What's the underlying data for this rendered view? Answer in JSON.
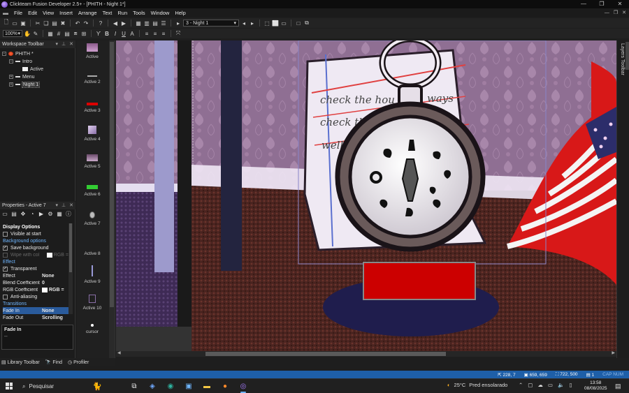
{
  "window": {
    "title": "Clickteam Fusion Developer 2.5+ - [PHITH - Night 1*]",
    "controls": [
      "—",
      "❐",
      "✕"
    ],
    "mdi_controls": [
      "—",
      "❐",
      "✕"
    ]
  },
  "menu": [
    "File",
    "Edit",
    "View",
    "Insert",
    "Arrange",
    "Text",
    "Run",
    "Tools",
    "Window",
    "Help"
  ],
  "toolbar": {
    "zoom": "100%",
    "frame_selector": "3 - Night 1"
  },
  "workspace": {
    "title": "Workspace Toolbar",
    "tree": [
      {
        "label": "PHITH *",
        "level": 0,
        "icon": "app"
      },
      {
        "label": "Intro",
        "level": 1,
        "icon": "frame"
      },
      {
        "label": "Active",
        "level": 2,
        "icon": "object"
      },
      {
        "label": "Menu",
        "level": 1,
        "icon": "frame"
      },
      {
        "label": "Night 1",
        "level": 1,
        "icon": "frame",
        "selected": true
      }
    ]
  },
  "properties": {
    "title": "Properties - Active 7",
    "rows": [
      {
        "type": "section",
        "name": "Display Options"
      },
      {
        "type": "check",
        "name": "Visible at start",
        "checked": false
      },
      {
        "type": "cat",
        "name": "Background options"
      },
      {
        "type": "check",
        "name": "Save background",
        "checked": true
      },
      {
        "type": "check-disabled",
        "name": "Wipe with col",
        "value": "RGB =",
        "checked": false
      },
      {
        "type": "cat",
        "name": "Effect"
      },
      {
        "type": "check",
        "name": "Transparent",
        "checked": true
      },
      {
        "type": "value",
        "name": "Effect",
        "value": "None"
      },
      {
        "type": "value",
        "name": "Blend Coefficient",
        "value": "0"
      },
      {
        "type": "color",
        "name": "RGB Coefficient",
        "value": "RGB ="
      },
      {
        "type": "check",
        "name": "Anti-aliasing",
        "checked": false
      },
      {
        "type": "cat",
        "name": "Transitions"
      },
      {
        "type": "value",
        "name": "Fade In",
        "value": "None",
        "highlight": true
      },
      {
        "type": "value",
        "name": "Fade Out",
        "value": "Scrolling"
      }
    ],
    "description_title": "Fade In",
    "description_text": "--"
  },
  "bottom_tabs": [
    "Library Toolbar",
    "Find",
    "Profiler"
  ],
  "shelf": {
    "items": [
      "Active",
      "Active 2",
      "Active 3",
      "Active 4",
      "Active 5",
      "Active 6",
      "Active 7",
      "Active 8",
      "Active 9",
      "Active 10",
      "cursor"
    ]
  },
  "scene": {
    "note_text": [
      "check the hou",
      "ways",
      "check the",
      "oo",
      "well i"
    ]
  },
  "layers": {
    "title": "Layers Toolbar"
  },
  "status": {
    "mouse": "228, 7",
    "object": "659, 659",
    "frame": "722, 500",
    "layer": "1",
    "tail": "CAP NUM"
  },
  "taskbar": {
    "search": "Pesquisar",
    "weather_temp": "25°C",
    "weather_desc": "Pred ensolarado",
    "time": "13:58",
    "date": "08/08/2025"
  },
  "colors": {
    "accent": "#1e5fa8",
    "selection": "#2a5b9c",
    "category_text": "#6fb6ff",
    "red_box": "#cc0000"
  }
}
